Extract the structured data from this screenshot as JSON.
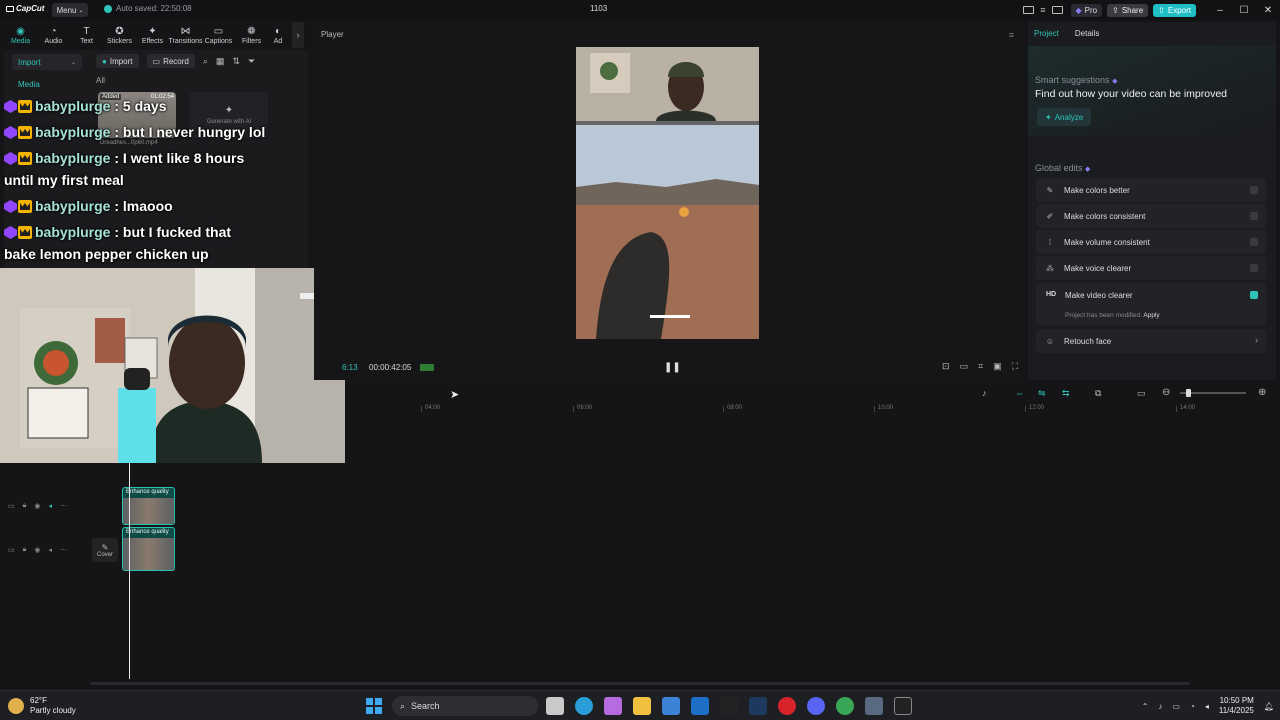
{
  "app": {
    "logo_text": "CapCut",
    "menu_label": "Menu",
    "autosave_text": "Auto saved: 22:50:08",
    "window_title": "1103",
    "pro_label": "Pro",
    "share_label": "Share",
    "export_label": "Export"
  },
  "toolbar": {
    "items": [
      {
        "label": "Media",
        "icon": "media-icon"
      },
      {
        "label": "Audio",
        "icon": "audio-icon"
      },
      {
        "label": "Text",
        "icon": "text-icon"
      },
      {
        "label": "Stickers",
        "icon": "stickers-icon"
      },
      {
        "label": "Effects",
        "icon": "effects-icon"
      },
      {
        "label": "Transitions",
        "icon": "transitions-icon"
      },
      {
        "label": "Captions",
        "icon": "captions-icon"
      },
      {
        "label": "Filters",
        "icon": "filters-icon"
      },
      {
        "label": "Ad",
        "icon": "adjust-icon"
      }
    ]
  },
  "media_panel": {
    "import_label": "Import",
    "media_label": "Media",
    "import_button": "Import",
    "record_button": "Record",
    "all_label": "All",
    "thumb_added": "Added",
    "thumb_duration": "01:02:54",
    "thumb_name": "Dreadhes...0p60.mp4",
    "generate_ai": "Generate with AI"
  },
  "chat": [
    {
      "user": "babyplurge",
      "text": " : 5 days"
    },
    {
      "user": "babyplurge",
      "text": " : but I never hungry lol"
    },
    {
      "user": "babyplurge",
      "text": " : I went like 8 hours"
    },
    {
      "user": "",
      "text": "until my first meal"
    },
    {
      "user": "babyplurge",
      "text": " : lmaooo"
    },
    {
      "user": "babyplurge",
      "text": " : but I fucked that"
    },
    {
      "user": "",
      "text": "bake lemon pepper chicken up"
    }
  ],
  "player": {
    "title": "Player",
    "current_time": "6:13",
    "total_time": "00:00:42:05"
  },
  "right_panel": {
    "tabs": [
      "Project",
      "Details"
    ],
    "smart_title": "Smart suggestions",
    "smart_sub": "Find out how your video can be improved",
    "analyze_label": "Analyze",
    "global_title": "Global edits",
    "items": [
      {
        "label": "Make colors better",
        "icon": "colors-icon",
        "on": false
      },
      {
        "label": "Make colors consistent",
        "icon": "consistency-icon",
        "on": false
      },
      {
        "label": "Make volume consistent",
        "icon": "volume-icon",
        "on": false
      },
      {
        "label": "Make voice clearer",
        "icon": "voice-icon",
        "on": false
      }
    ],
    "video_clearer": "Make video clearer",
    "video_clearer_badge": "HD",
    "modified_note": "Project has been modified.",
    "apply_label": "Apply",
    "retouch_label": "Retouch face"
  },
  "timeline": {
    "ticks": [
      "04:00",
      "06:00",
      "08:00",
      "10:00",
      "12:00",
      "14:00"
    ],
    "clip_label": "Enhance quality",
    "cover_label": "Cover"
  },
  "taskbar": {
    "temp": "62°F",
    "weather": "Partly cloudy",
    "search_placeholder": "Search",
    "time": "10:50 PM",
    "date": "11/4/2025"
  }
}
